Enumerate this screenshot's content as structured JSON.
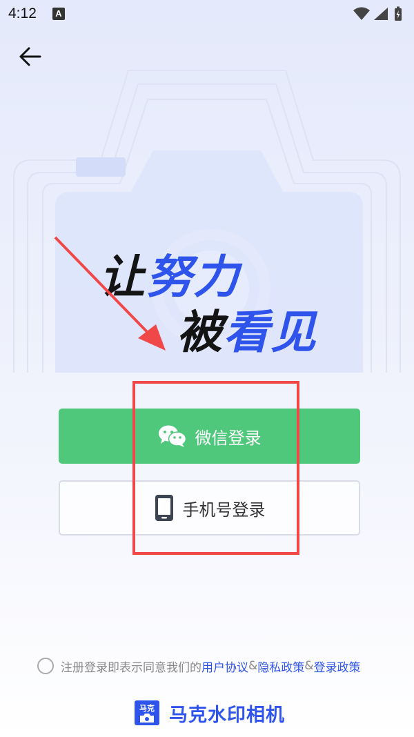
{
  "status_bar": {
    "time": "4:12",
    "notification_letter": "A",
    "icons": [
      "wifi-icon",
      "signal-icon",
      "battery-icon"
    ]
  },
  "header": {
    "back_icon": "arrow-left-icon"
  },
  "hero": {
    "line1_dark": "让",
    "line1_blue": "努力",
    "line2_dark": "被",
    "line2_blue": "看见",
    "colors": {
      "dark": "#141414",
      "blue": "#2f54eb"
    }
  },
  "login": {
    "wechat_label": "微信登录",
    "wechat_icon": "wechat-icon",
    "wechat_color": "#4fc87c",
    "phone_label": "手机号登录",
    "phone_icon": "smartphone-icon"
  },
  "agreement": {
    "prefix": "注册登录即表示同意我们的",
    "user_agreement": "用户协议",
    "sep1": "&",
    "privacy_policy": "隐私政策",
    "sep2": "&",
    "login_policy": "登录政策"
  },
  "brand": {
    "logo_text": "马克",
    "name": "马克水印相机"
  },
  "annotation": {
    "color": "#f04848"
  }
}
